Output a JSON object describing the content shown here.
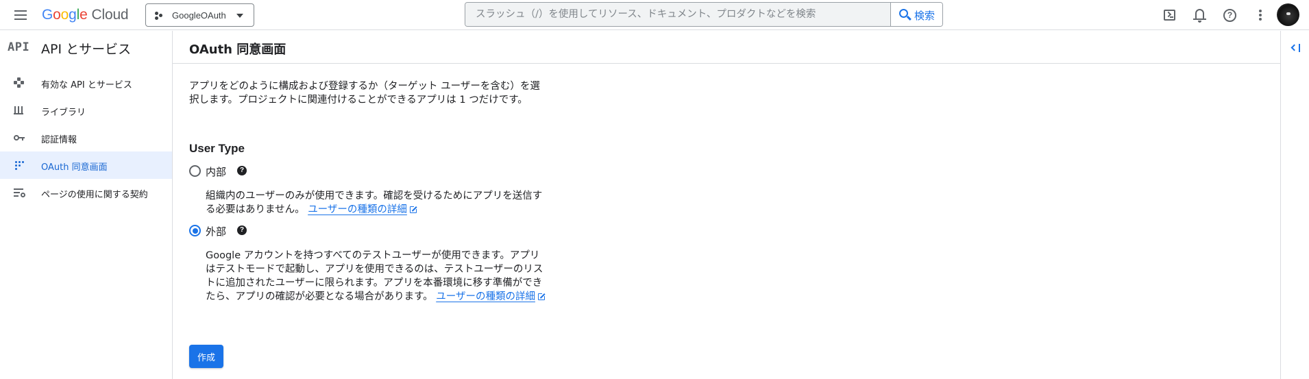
{
  "topbar": {
    "brand": {
      "g": "G",
      "o1": "o",
      "o2": "o",
      "g2": "g",
      "l": "l",
      "e": "e",
      "cloud": "Cloud"
    },
    "project": "GoogleOAuth",
    "search": {
      "placeholder": "スラッシュ（/）を使用してリソース、ドキュメント、プロダクトなどを検索",
      "button_label": "検索"
    },
    "icons": [
      "menu-icon",
      "terminal-icon",
      "bell-icon",
      "help-icon",
      "more-vert-icon",
      "avatar"
    ],
    "help_glyph": "?"
  },
  "sidebar": {
    "logo": "API",
    "title": "API とサービス",
    "items": [
      {
        "label": "有効な API とサービス",
        "icon": "move-icon",
        "active": false
      },
      {
        "label": "ライブラリ",
        "icon": "library-icon",
        "active": false
      },
      {
        "label": "認証情報",
        "icon": "key-icon",
        "active": false
      },
      {
        "label": "OAuth 同意画面",
        "icon": "consent-dots-icon",
        "active": true
      },
      {
        "label": "ページの使用に関する契約",
        "icon": "list-settings-icon",
        "active": false
      }
    ]
  },
  "main": {
    "title": "OAuth 同意画面",
    "description": "アプリをどのように構成および登録するか（ターゲット ユーザーを含む）を選択します。プロジェクトに関連付けることができるアプリは 1 つだけです。",
    "user_type_heading": "User Type",
    "help_glyph": "?",
    "options": {
      "internal": {
        "label": "内部",
        "checked": false,
        "description": "組織内のユーザーのみが使用できます。確認を受けるためにアプリを送信する必要はありません。",
        "link": "ユーザーの種類の詳細"
      },
      "external": {
        "label": "外部",
        "checked": true,
        "description": "Google アカウントを持つすべてのテストユーザーが使用できます。アプリはテストモードで起動し、アプリを使用できるのは、テストユーザーのリストに追加されたユーザーに限られます。アプリを本番環境に移す準備ができたら、アプリの確認が必要となる場合があります。",
        "link": "ユーザーの種類の詳細"
      }
    },
    "create_button": "作成"
  },
  "colors": {
    "accent": "#1a73e8",
    "active_bg": "#e8f0fe",
    "active_text": "#1967d2",
    "border": "#dadce0"
  }
}
